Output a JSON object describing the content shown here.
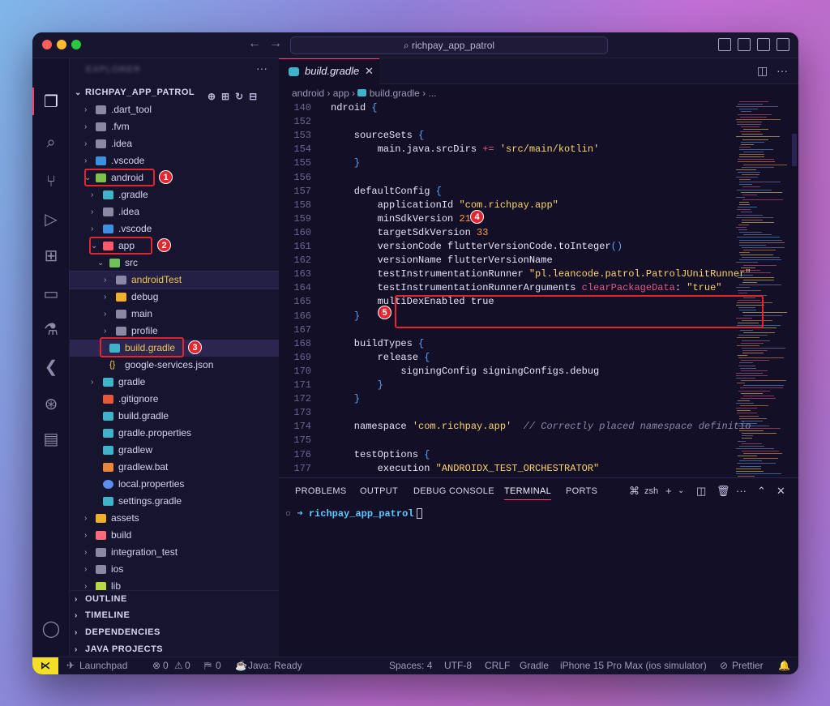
{
  "window": {
    "search_text": "richpay_app_patrol"
  },
  "sidebar": {
    "title": "EXPLORER",
    "root": "RICHPAY_APP_PATROL",
    "items": [
      {
        "label": ".dart_tool"
      },
      {
        "label": ".fvm"
      },
      {
        "label": ".idea"
      },
      {
        "label": ".vscode"
      },
      {
        "label": "android"
      },
      {
        "label": ".gradle"
      },
      {
        "label": ".idea"
      },
      {
        "label": ".vscode"
      },
      {
        "label": "app"
      },
      {
        "label": "src"
      },
      {
        "label": "androidTest"
      },
      {
        "label": "debug"
      },
      {
        "label": "main"
      },
      {
        "label": "profile"
      },
      {
        "label": "build.gradle"
      },
      {
        "label": "google-services.json"
      },
      {
        "label": "gradle"
      },
      {
        "label": ".gitignore"
      },
      {
        "label": "build.gradle"
      },
      {
        "label": "gradle.properties"
      },
      {
        "label": "gradlew"
      },
      {
        "label": "gradlew.bat"
      },
      {
        "label": "local.properties"
      },
      {
        "label": "settings.gradle"
      },
      {
        "label": "assets"
      },
      {
        "label": "build"
      },
      {
        "label": "integration_test"
      },
      {
        "label": "ios"
      },
      {
        "label": "lib"
      }
    ],
    "sections": [
      "OUTLINE",
      "TIMELINE",
      "DEPENDENCIES",
      "JAVA PROJECTS"
    ]
  },
  "annotations": [
    "1",
    "2",
    "3",
    "4",
    "5"
  ],
  "editor": {
    "tab": "build.gradle",
    "breadcrumb": [
      "android",
      "app",
      "build.gradle",
      "..."
    ],
    "lines": [
      {
        "n": "140",
        "t": "ndroid {"
      },
      {
        "n": "152",
        "t": ""
      },
      {
        "n": "153",
        "t": "    sourceSets {"
      },
      {
        "n": "154",
        "t": "        main.java.srcDirs += 'src/main/kotlin'"
      },
      {
        "n": "155",
        "t": "    }"
      },
      {
        "n": "156",
        "t": ""
      },
      {
        "n": "157",
        "t": "    defaultConfig {"
      },
      {
        "n": "158",
        "t": "        applicationId \"com.richpay.app\""
      },
      {
        "n": "159",
        "t": "        minSdkVersion 21"
      },
      {
        "n": "160",
        "t": "        targetSdkVersion 33"
      },
      {
        "n": "161",
        "t": "        versionCode flutterVersionCode.toInteger()"
      },
      {
        "n": "162",
        "t": "        versionName flutterVersionName"
      },
      {
        "n": "163",
        "t": "        testInstrumentationRunner \"pl.leancode.patrol.PatrolJUnitRunner\""
      },
      {
        "n": "164",
        "t": "        testInstrumentationRunnerArguments clearPackageData: \"true\""
      },
      {
        "n": "165",
        "t": "        multiDexEnabled true"
      },
      {
        "n": "166",
        "t": "    }"
      },
      {
        "n": "167",
        "t": ""
      },
      {
        "n": "168",
        "t": "    buildTypes {"
      },
      {
        "n": "169",
        "t": "        release {"
      },
      {
        "n": "170",
        "t": "            signingConfig signingConfigs.debug"
      },
      {
        "n": "171",
        "t": "        }"
      },
      {
        "n": "172",
        "t": "    }"
      },
      {
        "n": "173",
        "t": ""
      },
      {
        "n": "174",
        "t": "    namespace 'com.richpay.app'  // Correctly placed namespace definitio"
      },
      {
        "n": "175",
        "t": ""
      },
      {
        "n": "176",
        "t": "    testOptions {"
      },
      {
        "n": "177",
        "t": "        execution \"ANDROIDX_TEST_ORCHESTRATOR\""
      }
    ]
  },
  "panel": {
    "tabs": [
      "PROBLEMS",
      "OUTPUT",
      "DEBUG CONSOLE",
      "TERMINAL",
      "PORTS"
    ],
    "shell": "zsh",
    "prompt_dir": "richpay_app_patrol"
  },
  "status": {
    "launchpad": "Launchpad",
    "errors": "0",
    "warnings": "0",
    "ports": "0",
    "java": "Java: Ready",
    "spaces": "Spaces: 4",
    "encoding": "UTF-8",
    "eol": "CRLF",
    "language": "Gradle",
    "device": "iPhone 15 Pro Max (ios simulator)",
    "prettier": "Prettier"
  },
  "colors": {
    "accent": "#ff3a6d",
    "annotation": "#e3262e",
    "string": "#ffd56b",
    "number": "#ff9a4d"
  }
}
